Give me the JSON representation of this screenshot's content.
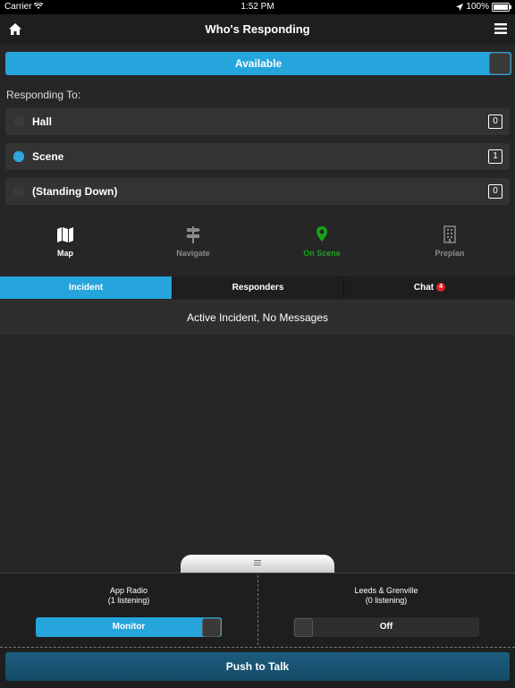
{
  "status_bar": {
    "carrier": "Carrier",
    "time": "1:52 PM",
    "battery": "100%"
  },
  "nav": {
    "title": "Who's Responding"
  },
  "availability": {
    "label": "Available"
  },
  "responding": {
    "label": "Responding To:",
    "options": [
      {
        "label": "Hall",
        "count": "0",
        "selected": false
      },
      {
        "label": "Scene",
        "count": "1",
        "selected": true
      },
      {
        "label": "(Standing Down)",
        "count": "0",
        "selected": false
      }
    ]
  },
  "actions": [
    {
      "label": "Map",
      "icon": "map-icon",
      "color": "#ffffff"
    },
    {
      "label": "Navigate",
      "icon": "signpost-icon",
      "color": "#8a8a8a"
    },
    {
      "label": "On Scene",
      "icon": "location-pin-icon",
      "color": "#1aa31a"
    },
    {
      "label": "Preplan",
      "icon": "building-icon",
      "color": "#8a8a8a"
    }
  ],
  "tabs": [
    {
      "label": "Incident",
      "active": true
    },
    {
      "label": "Responders",
      "active": false
    },
    {
      "label": "Chat",
      "active": false,
      "badge": "4"
    }
  ],
  "messages": {
    "empty_text": "Active Incident, No Messages"
  },
  "radios": [
    {
      "name": "App Radio",
      "listening": "(1 listening)",
      "toggle_label": "Monitor",
      "on": true
    },
    {
      "name": "Leeds & Grenville",
      "listening": "(0 listening)",
      "toggle_label": "Off",
      "on": false
    }
  ],
  "push_to_talk": {
    "label": "Push to Talk"
  },
  "colors": {
    "accent": "#25a5dc",
    "on_scene": "#1aa31a",
    "badge": "#e02020"
  }
}
